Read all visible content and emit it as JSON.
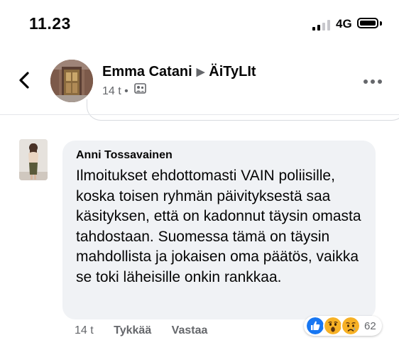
{
  "status_bar": {
    "time": "11.23",
    "network": "4G"
  },
  "header": {
    "author": "Emma Catani",
    "group": "ÄiTyLIt",
    "meta": "14 t •",
    "audience_icon": "members-icon"
  },
  "comment": {
    "author": "Anni Tossavainen",
    "text": "Ilmoitukset ehdottomasti VAIN poliisille, koska toisen ryhmän päivityksestä saa käsityksen, että on kadonnut täysin omasta tahdostaan. Suomessa tämä on täysin mahdollista ja jokaisen oma päätös, vaikka se toki läheisille onkin rankkaa."
  },
  "actions": {
    "time": "14 t",
    "like": "Tykkää",
    "reply": "Vastaa"
  },
  "reactions": {
    "types": [
      "like",
      "wow",
      "sad"
    ],
    "count": "62"
  },
  "colors": {
    "facebook_blue": "#1877f2",
    "secondary_text": "#65676b",
    "bubble": "#f0f2f5",
    "reaction_yellow": "#f7b125"
  }
}
